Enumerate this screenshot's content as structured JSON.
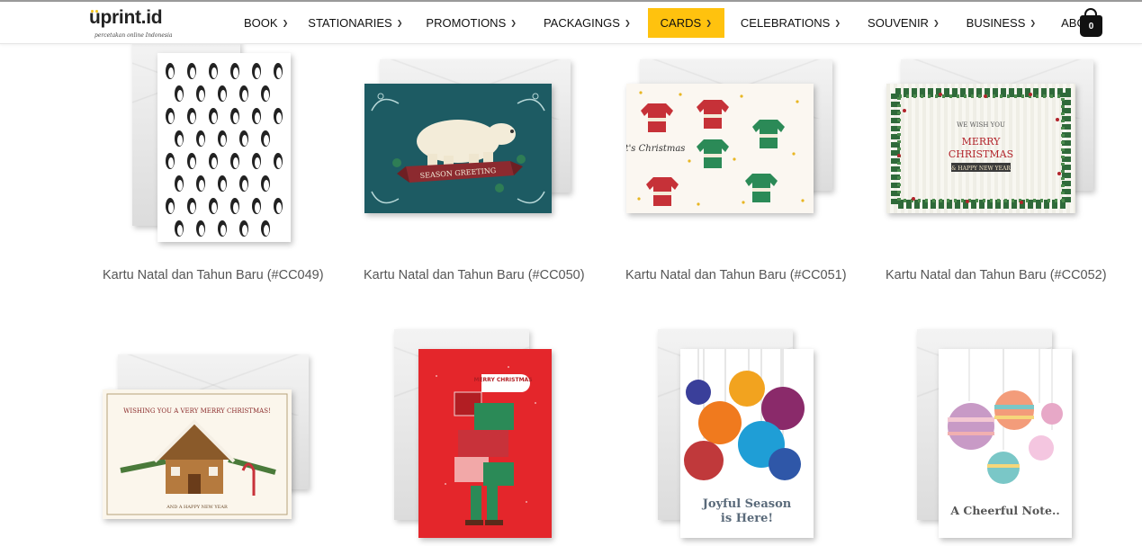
{
  "brand": {
    "name": "uprint.id",
    "tagline": "percetakan online Indonesia"
  },
  "nav": {
    "items": [
      {
        "label": "BOOK",
        "has_dropdown": true,
        "active": false
      },
      {
        "label": "STATIONARIES",
        "has_dropdown": true,
        "active": false
      },
      {
        "label": "PROMOTIONS",
        "has_dropdown": true,
        "active": false
      },
      {
        "label": "PACKAGINGS",
        "has_dropdown": true,
        "active": false
      },
      {
        "label": "CARDS",
        "has_dropdown": true,
        "active": true
      },
      {
        "label": "CELEBRATIONS",
        "has_dropdown": true,
        "active": false
      },
      {
        "label": "SOUVENIR",
        "has_dropdown": true,
        "active": false
      },
      {
        "label": "BUSINESS",
        "has_dropdown": true,
        "active": false
      },
      {
        "label": "ABOUT",
        "has_dropdown": false,
        "active": false
      }
    ],
    "active_color": "#ffc20e"
  },
  "cart": {
    "icon": "shopping-bag-icon",
    "count": "0"
  },
  "products": [
    {
      "title": "Kartu Natal dan Tahun Baru (#CC049)",
      "design": "penguins"
    },
    {
      "title": "Kartu Natal dan Tahun Baru (#CC050)",
      "design": "polar-bear",
      "card_text": "SEASON GREETING"
    },
    {
      "title": "Kartu Natal dan Tahun Baru (#CC051)",
      "design": "sweaters",
      "card_text": "It's Christmas"
    },
    {
      "title": "Kartu Natal dan Tahun Baru (#CC052)",
      "design": "wreath-frame",
      "card_text_1": "WE WISH YOU",
      "card_text_2": "MERRY",
      "card_text_3": "CHRISTMAS",
      "card_text_4": "& HAPPY NEW YEAR"
    },
    {
      "title": "",
      "design": "gingerbread-house",
      "card_text_1": "WISHING YOU A VERY MERRY CHRISTMAS!",
      "card_text_2": "AND A HAPPY NEW YEAR"
    },
    {
      "title": "",
      "design": "gift-stack",
      "card_text": "MERRY CHRISTMAS"
    },
    {
      "title": "",
      "design": "ornaments",
      "card_text_1": "Joyful Season",
      "card_text_2": "is Here!"
    },
    {
      "title": "",
      "design": "pastel-ornaments",
      "card_text": "A Cheerful Note.."
    }
  ],
  "colors": {
    "teal": "#1d5b63",
    "red": "#e4262b",
    "christmas_green": "#2b8a57",
    "christmas_red": "#c63138"
  }
}
